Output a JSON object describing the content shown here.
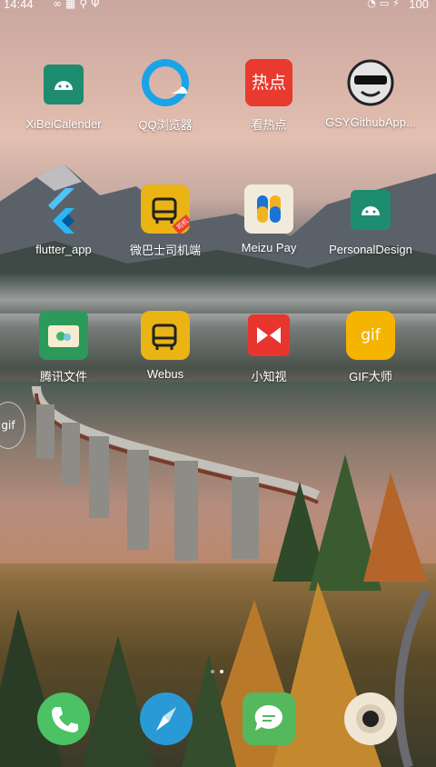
{
  "status_bar": {
    "time": "14:44",
    "left_icons": [
      "link-icon",
      "sd-card-icon",
      "usb-icon",
      "usb-debug-icon"
    ],
    "right_icons": [
      "wifi-icon",
      "sim-signal-icon",
      "charging-icon"
    ],
    "battery": "100"
  },
  "apps": [
    {
      "label": "XiBeiCalender"
    },
    {
      "label": "QQ浏览器"
    },
    {
      "label": "看热点",
      "icon_text": "热点"
    },
    {
      "label": "GSYGithubApp..."
    },
    {
      "label": "flutter_app"
    },
    {
      "label": "微巴士司机端",
      "badge": "司机"
    },
    {
      "label": "Meizu Pay"
    },
    {
      "label": "PersonalDesign"
    },
    {
      "label": "腾讯文件"
    },
    {
      "label": "Webus"
    },
    {
      "label": "小知视"
    },
    {
      "label": "GIF大师",
      "icon_text": "gif"
    }
  ],
  "floating_ball": {
    "text": "gif"
  },
  "pager": {
    "pages": 2,
    "current": 2
  },
  "dock": [
    "phone-icon",
    "browser-compass-icon",
    "messages-icon",
    "camera-icon"
  ]
}
